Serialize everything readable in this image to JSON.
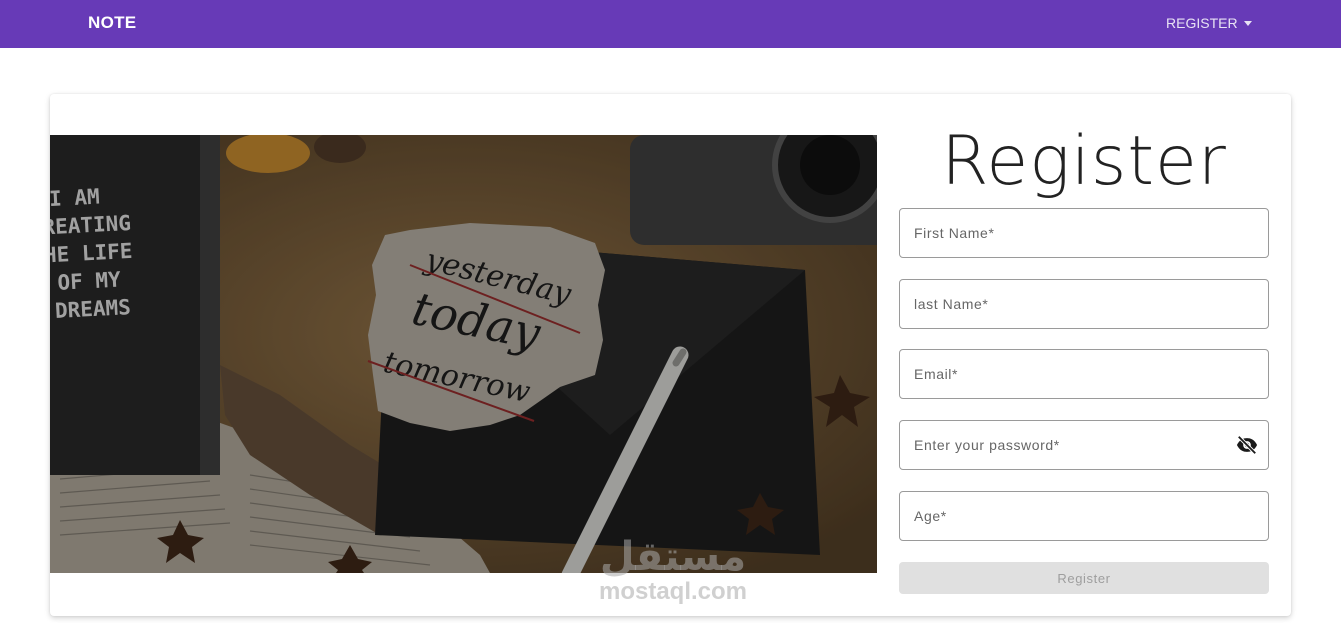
{
  "navbar": {
    "brand": "NOTE",
    "menu_label": "REGISTER",
    "background_color": "#673ab7"
  },
  "form": {
    "title": "Register",
    "fields": {
      "first_name": {
        "placeholder": "First Name*"
      },
      "last_name": {
        "placeholder": "last Name*"
      },
      "email": {
        "placeholder": "Email*"
      },
      "password": {
        "placeholder": "Enter your password*",
        "toggle_icon": "eye-off-icon"
      },
      "age": {
        "placeholder": "Age*"
      }
    },
    "submit_label": "Register"
  },
  "hero_image": {
    "notebook_text": [
      "I AM",
      "REATING",
      "HE LIFE",
      "OF MY",
      "DREAMS"
    ],
    "note_text": [
      "yesterday",
      "today",
      "tomorrow"
    ]
  },
  "watermark": {
    "arabic": "مستقل",
    "latin": "mostaql.com"
  }
}
